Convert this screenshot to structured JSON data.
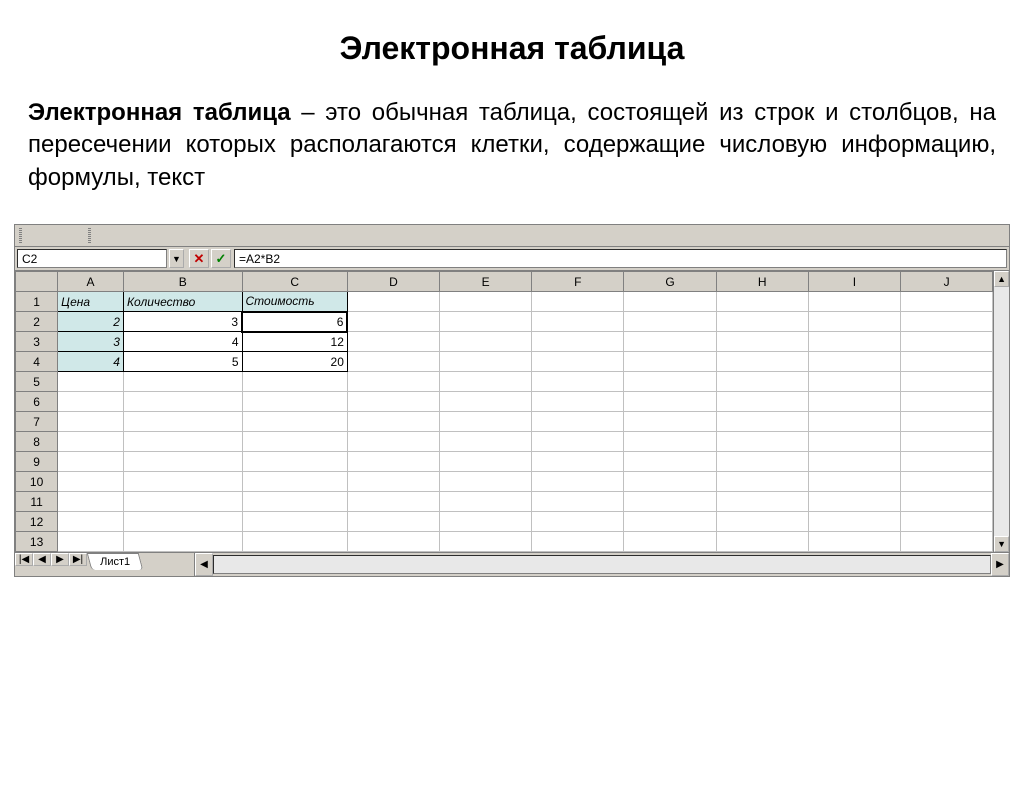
{
  "title": "Электронная таблица",
  "description_bold": "Электронная таблица",
  "description_rest": " – это обычная таблица, состоящей из строк и столбцов, на пересечении которых располагаются клетки, содержащие числовую информацию, формулы, текст",
  "spreadsheet": {
    "name_box": "C2",
    "formula": "=A2*B2",
    "columns": [
      "A",
      "B",
      "C",
      "D",
      "E",
      "F",
      "G",
      "H",
      "I",
      "J"
    ],
    "row_numbers": [
      "1",
      "2",
      "3",
      "4",
      "5",
      "6",
      "7",
      "8",
      "9",
      "10",
      "11",
      "12",
      "13"
    ],
    "headers": {
      "A": "Цена",
      "B": "Количество",
      "C": "Стоимость"
    },
    "data": [
      {
        "A": "2",
        "B": "3",
        "C": "6"
      },
      {
        "A": "3",
        "B": "4",
        "C": "12"
      },
      {
        "A": "4",
        "B": "5",
        "C": "20"
      }
    ],
    "sheet_name": "Лист1",
    "nav_first": "|◀",
    "nav_prev": "◀",
    "nav_next": "▶",
    "nav_last": "▶|",
    "scroll_up": "▲",
    "scroll_down": "▼",
    "scroll_left": "◀",
    "scroll_right": "▶",
    "dropdown": "▼",
    "cancel": "✕",
    "accept": "✓"
  }
}
